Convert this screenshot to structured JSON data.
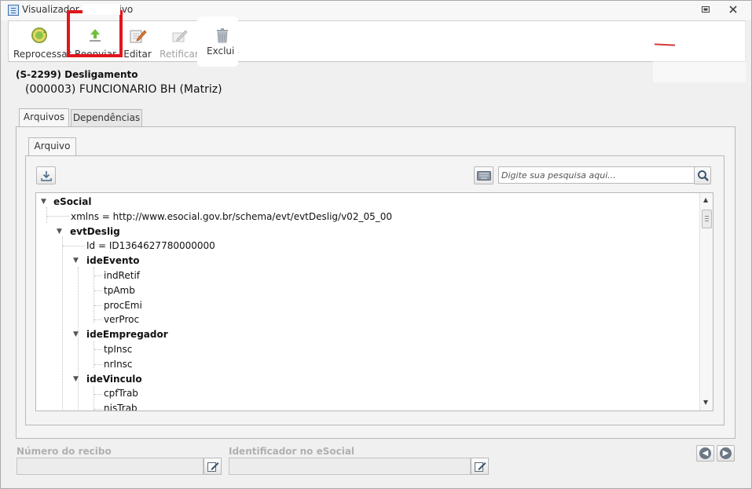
{
  "window": {
    "title": "Visualizador de Arquivo"
  },
  "toolbar": {
    "buttons": [
      {
        "label": "Reprocessar",
        "icon": "reprocess-icon",
        "enabled": true
      },
      {
        "label": "Reenviar",
        "icon": "upload-icon",
        "enabled": true
      },
      {
        "label": "Editar",
        "icon": "edit-icon",
        "enabled": true
      },
      {
        "label": "Retificar",
        "icon": "rectify-icon",
        "enabled": false
      },
      {
        "label": "Excluir",
        "icon": "trash-icon",
        "enabled": true
      }
    ],
    "highlight_color": "#e2151c"
  },
  "event": {
    "code": "(S-2299) Desligamento",
    "employer": "(000003) FUNCIONARIO BH (Matriz)"
  },
  "tabs": [
    {
      "label": "Arquivos",
      "active": true
    },
    {
      "label": "Dependências",
      "active": false
    }
  ],
  "inner_tab": {
    "label": "Arquivo"
  },
  "search": {
    "placeholder": "Digite sua pesquisa aqui..."
  },
  "tree": {
    "rows": [
      {
        "text": "eSocial",
        "bold": true,
        "toggle": "expanded"
      },
      {
        "text": "xmlns = http://www.esocial.gov.br/schema/evt/evtDeslig/v02_05_00",
        "bold": false
      },
      {
        "text": "evtDeslig",
        "bold": true,
        "toggle": "expanded"
      },
      {
        "text": "Id = ID1364627780000000",
        "bold": false
      },
      {
        "text": "ideEvento",
        "bold": true,
        "toggle": "expanded"
      },
      {
        "text": "indRetif",
        "bold": false
      },
      {
        "text": "tpAmb",
        "bold": false
      },
      {
        "text": "procEmi",
        "bold": false
      },
      {
        "text": "verProc",
        "bold": false
      },
      {
        "text": "ideEmpregador",
        "bold": true,
        "toggle": "expanded"
      },
      {
        "text": "tpInsc",
        "bold": false
      },
      {
        "text": "nrInsc",
        "bold": false
      },
      {
        "text": "ideVinculo",
        "bold": true,
        "toggle": "expanded"
      },
      {
        "text": "cpfTrab",
        "bold": false
      },
      {
        "text": "nisTrab",
        "bold": false
      }
    ]
  },
  "footer": {
    "receipt_label": "Número do recibo",
    "receipt_value": "",
    "esocial_id_label": "Identificador no eSocial",
    "esocial_id_value": ""
  }
}
